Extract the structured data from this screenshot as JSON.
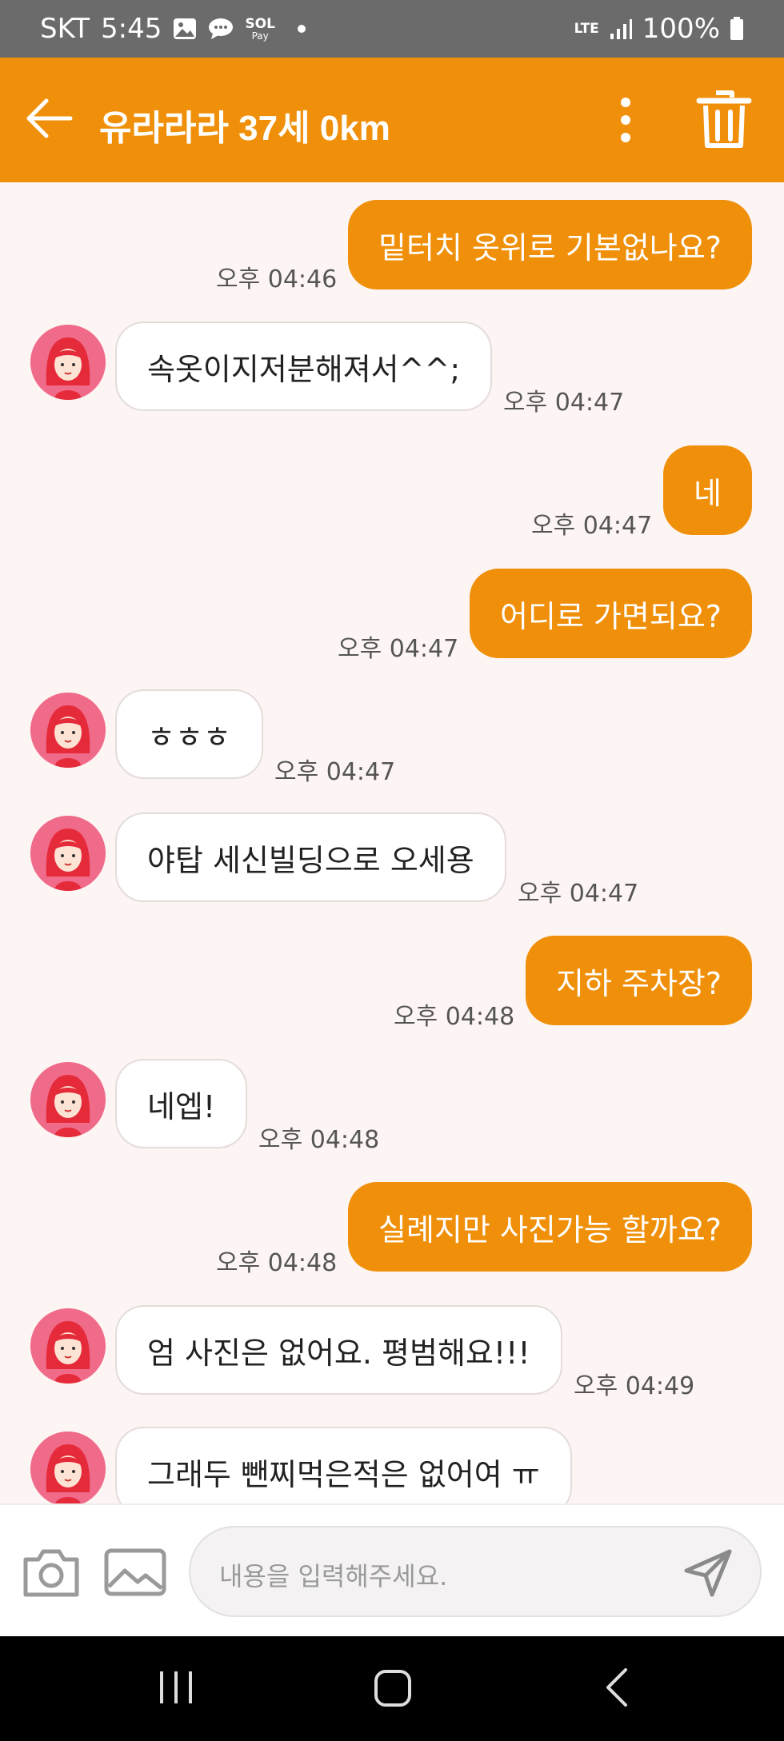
{
  "status_bar": {
    "carrier": "SKT",
    "time": "5:45",
    "sol_line1": "SOL",
    "sol_line2": "Pay",
    "network": "LTE",
    "battery": "100%"
  },
  "header": {
    "title": "유라라라 37세 0km",
    "icons": [
      "arrow-left-icon",
      "more-vert-icon",
      "trash-icon"
    ]
  },
  "colors": {
    "accent": "#f0900a",
    "chat_background": "#fdf5f4",
    "incoming_bubble": "#ffffff",
    "avatar": "#f06b8a"
  },
  "messages": [
    {
      "side": "out",
      "text": "밑터치 옷위로 기본없나요?",
      "time": "오후 04:46"
    },
    {
      "side": "in",
      "text": "속옷이지저분해져서^^;",
      "time": "오후 04:47"
    },
    {
      "side": "out",
      "text": "네",
      "time": "오후 04:47"
    },
    {
      "side": "out",
      "text": "어디로 가면되요?",
      "time": "오후 04:47"
    },
    {
      "side": "in",
      "text": "ㅎㅎㅎ",
      "time": "오후 04:47"
    },
    {
      "side": "in",
      "text": "야탑 세신빌딩으로 오세용",
      "time": "오후 04:47"
    },
    {
      "side": "out",
      "text": "지하 주차장?",
      "time": "오후 04:48"
    },
    {
      "side": "in",
      "text": "네엡!",
      "time": "오후 04:48"
    },
    {
      "side": "out",
      "text": "실례지만 사진가능 할까요?",
      "time": "오후 04:48"
    },
    {
      "side": "in",
      "text": "엄 사진은 없어요. 평범해요!!!",
      "time": "오후 04:49"
    },
    {
      "side": "in",
      "text": "그래두 뺀찌먹은적은 없어여 ㅠ",
      "time": ""
    }
  ],
  "composer": {
    "placeholder": "내용을 입력해주세요.",
    "icons": [
      "camera-icon",
      "image-icon",
      "send-icon"
    ]
  },
  "nav_bar": {
    "icons": [
      "recent-apps-icon",
      "home-icon",
      "back-icon"
    ]
  }
}
